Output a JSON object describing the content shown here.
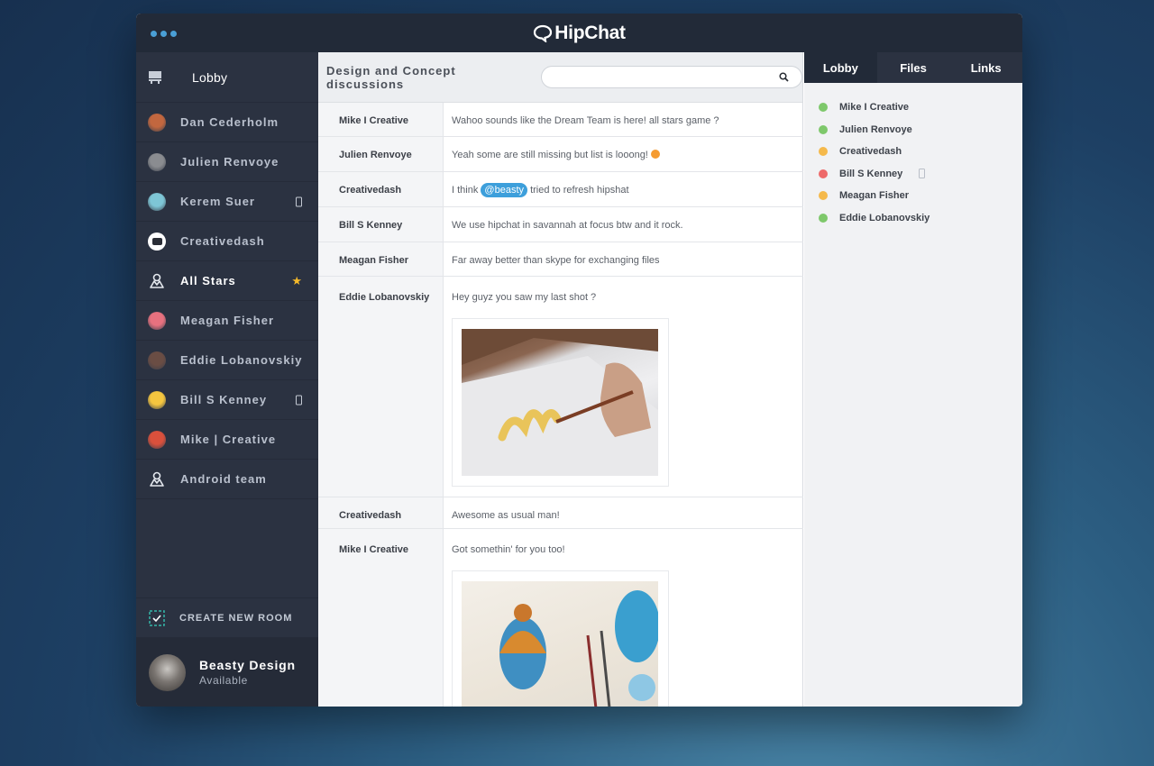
{
  "app": {
    "title": "HipChat"
  },
  "sidebar": {
    "lobby": {
      "label": "Lobby"
    },
    "items": [
      {
        "label": "Dan Cederholm",
        "kind": "person",
        "color": "#c2673f"
      },
      {
        "label": "Julien Renvoye",
        "kind": "person",
        "color": "#8a8c90"
      },
      {
        "label": "Kerem Suer",
        "kind": "person",
        "color": "#7ec6d6",
        "mobile": true
      },
      {
        "label": "Creativedash",
        "kind": "logo",
        "color": "#2a2d36"
      },
      {
        "label": "All Stars",
        "kind": "room",
        "active": true,
        "starred": true
      },
      {
        "label": "Meagan Fisher",
        "kind": "person",
        "color": "#e7717f"
      },
      {
        "label": "Eddie Lobanovskiy",
        "kind": "person",
        "color": "#6a4d44"
      },
      {
        "label": "Bill S Kenney",
        "kind": "person",
        "color": "#f5c63f",
        "mobile": true
      },
      {
        "label": "Mike | Creative",
        "kind": "person",
        "color": "#d9503c"
      },
      {
        "label": "Android team",
        "kind": "room"
      }
    ],
    "create_room": "CREATE NEW ROOM",
    "me": {
      "name": "Beasty Design",
      "status": "Available"
    }
  },
  "chat": {
    "room_title": "Design and Concept discussions",
    "search_placeholder": "",
    "messages": [
      {
        "author": "Mike I Creative",
        "text": "Wahoo sounds like the Dream Team is here! all stars game ?"
      },
      {
        "author": "Julien Renvoye",
        "text": "Yeah some are still missing but list is looong!"
      },
      {
        "author": "Creativedash",
        "pre": "I think",
        "mention": "@beasty",
        "post": "tried to refresh hipshat"
      },
      {
        "author": "Bill S Kenney",
        "text": "We use hipchat in savannah at focus btw and it rock."
      },
      {
        "author": "Meagan Fisher",
        "text": "Far away better than skype for exchanging files"
      },
      {
        "author": "Eddie Lobanovskiy",
        "text": "Hey guyz you saw my last shot ?"
      },
      {
        "author": "Creativedash",
        "text": "Awesome as usual man!"
      },
      {
        "author": "Mike I Creative",
        "text": "Got somethin' for you too!"
      }
    ]
  },
  "right_panel": {
    "tabs": [
      "Lobby",
      "Files",
      "Links"
    ],
    "people": [
      {
        "name": "Mike I Creative",
        "status_color": "#7ec86b"
      },
      {
        "name": "Julien Renvoye",
        "status_color": "#7ec86b"
      },
      {
        "name": "Creativedash",
        "status_color": "#f5b94b"
      },
      {
        "name": "Bill S Kenney",
        "status_color": "#ee6a6a",
        "mobile": true
      },
      {
        "name": "Meagan Fisher",
        "status_color": "#f5b94b"
      },
      {
        "name": "Eddie Lobanovskiy",
        "status_color": "#7ec86b"
      }
    ]
  }
}
